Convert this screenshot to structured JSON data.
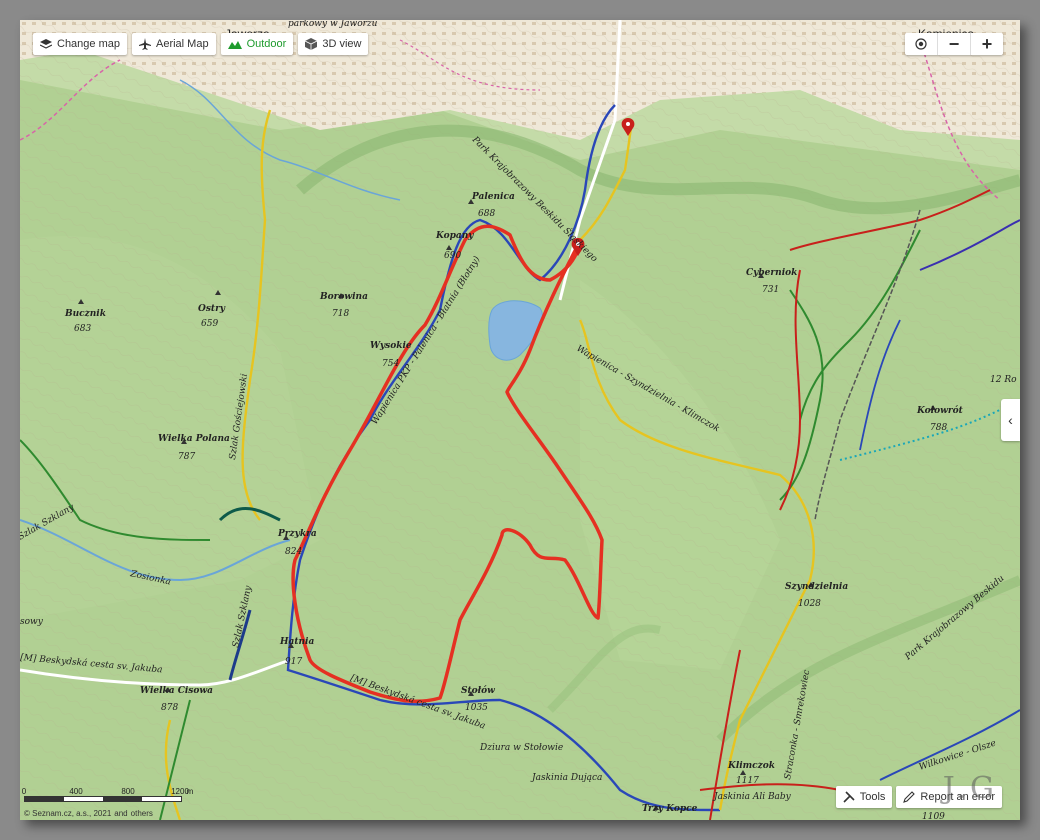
{
  "toolbar": {
    "change_map": "Change map",
    "aerial_map": "Aerial Map",
    "outdoor": "Outdoor",
    "view_3d": "3D view"
  },
  "zoom": {
    "locate": "",
    "zoom_out": "−",
    "zoom_in": "+"
  },
  "sidebar_toggle": "‹",
  "bottom": {
    "tools": "Tools",
    "report": "Report an error"
  },
  "watermark": "J.G",
  "scale": {
    "labels": [
      "0",
      "400",
      "800",
      "1200"
    ],
    "unit": "m"
  },
  "attribution": {
    "seznam": "© Seznam.cz, a.s., 2021",
    "and": "and",
    "others": "others"
  },
  "places": {
    "jaworze": "Jaworze",
    "jaworze_park": "parkowy w Jaworzu",
    "kamienica": "Kamienica",
    "bucznik": "Bucznik",
    "bucznik_h": "683",
    "ostry": "Ostry",
    "ostry_h": "659",
    "borowina": "Borowina",
    "borowina_h": "718",
    "palenica": "Palenica",
    "palenica_h": "688",
    "kopany": "Kopany",
    "kopany_h": "690",
    "wysokie": "Wysokie",
    "wysokie_h": "754",
    "cyberniok": "Cyberniok",
    "cyberniok_h": "731",
    "kolowrot": "Kołowrót",
    "kolowrot_h": "788",
    "wielka_polana": "Wielka Polana",
    "wielka_polana_h": "787",
    "przykra": "Przykra",
    "przykra_h": "824",
    "szyndzielnia": "Szyndzielnia",
    "szyndzielnia_h": "1028",
    "hatnia": "Hatnia",
    "hatnia_h": "917",
    "wielka_cisowa": "Wielka Cisowa",
    "wielka_cisowa_h": "878",
    "stolow": "Stołów",
    "stolow_h": "1035",
    "klimczok": "Klimczok",
    "klimczok_h": "1117",
    "trzy_kopce": "Trzy Kopce",
    "trzy_kopce_h": "1109",
    "zosionka": "Zosionka",
    "dziura": "Dziura w Stołowie",
    "jaskinia_dujaca": "Jaskinia Dująca",
    "jaskinia_ali": "Jaskinia Ali Baby",
    "park1": "Park Krajobrazowy Beskidu Śląskiego",
    "park2": "Park Krajobrazowy Beskidu",
    "trail_palenica": "Wapienica PKP - Palenica - Błatnia (Błotny)",
    "trail_jakuba": "[M] Beskydská cesta sv. Jakuba",
    "trail_jakuba2": "[M] Beskydská cesta sv. Jakuba",
    "trail_szlak_szklany": "Szlak Szklany",
    "trail_szlak_szklany2": "Szlak Szklany",
    "trail_gosc": "Szlak Gościejowski",
    "trail_wilkowice": "Wilkowice - Olsze",
    "trail_straconka": "Straconka - Smrekowiec",
    "trail_yellow": "Wapienica - Szyndzielnia - Klimczok",
    "trail_sowy": "sowy",
    "gen": "12 Ro"
  }
}
